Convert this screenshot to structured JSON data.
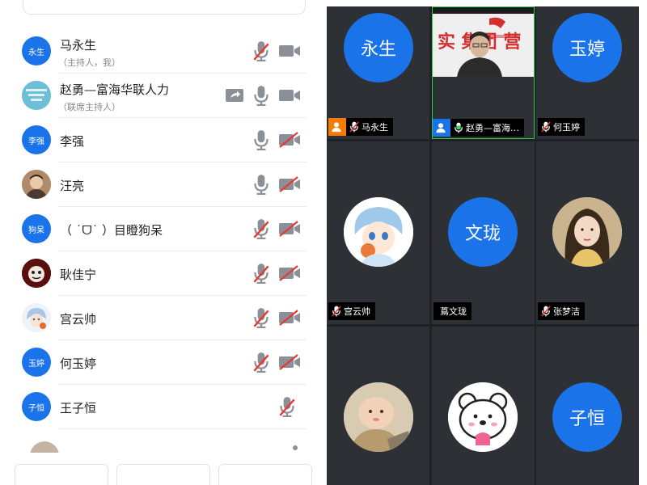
{
  "participants": [
    {
      "avatar_text": "永生",
      "name": "马永生",
      "role": "（主持人，我）"
    },
    {
      "avatar_text": "",
      "name": "赵勇—富海华联人力",
      "role": "（联席主持人）"
    },
    {
      "avatar_text": "李强",
      "name": "李强",
      "role": ""
    },
    {
      "avatar_text": "",
      "name": "汪亮",
      "role": ""
    },
    {
      "avatar_text": "狗呆",
      "name": "（ ˙ᗜ˙ ）目瞪狗呆",
      "role": ""
    },
    {
      "avatar_text": "",
      "name": "耿佳宁",
      "role": ""
    },
    {
      "avatar_text": "",
      "name": "宫云帅",
      "role": ""
    },
    {
      "avatar_text": "玉婷",
      "name": "何玉婷",
      "role": ""
    },
    {
      "avatar_text": "子恒",
      "name": "王子恒",
      "role": ""
    }
  ],
  "tiles": [
    {
      "avatar_text": "永生",
      "label": "马永生"
    },
    {
      "avatar_text": "",
      "label": "赵勇—富海…",
      "video_sign": "实  集团  营"
    },
    {
      "avatar_text": "玉婷",
      "label": "何玉婷"
    },
    {
      "avatar_text": "",
      "label": "宫云帅"
    },
    {
      "avatar_text": "文珑",
      "label": "蔦文珑"
    },
    {
      "avatar_text": "",
      "label": "张梦洁"
    },
    {
      "avatar_text": "",
      "label": ""
    },
    {
      "avatar_text": "",
      "label": ""
    },
    {
      "avatar_text": "子恒",
      "label": ""
    }
  ],
  "icons": {
    "mic": "microphone-icon",
    "mic_muted": "microphone-muted-icon",
    "cam": "camera-icon",
    "cam_off": "camera-off-icon",
    "share": "screen-share-icon",
    "host": "host-user-icon"
  },
  "colors": {
    "accent": "#1a73e8",
    "muted_red": "#e53935",
    "icon_gray": "#8a8f98",
    "host_orange": "#f57c00"
  }
}
